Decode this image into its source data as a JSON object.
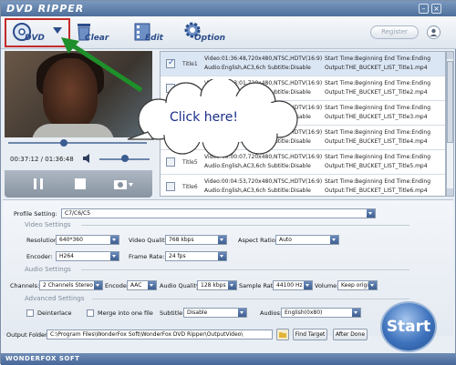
{
  "app": {
    "title": "DVD RIPPER",
    "brand": "WONDERFOX SOFT",
    "register_label": "Register"
  },
  "toolbar": {
    "dvd_label": "DVD",
    "clear_label": "Clear",
    "edit_label": "Edit",
    "option_label": "Option"
  },
  "player": {
    "time": "00:37:12 / 01:36:48",
    "seek_progress": 0.4,
    "volume_level": 0.5
  },
  "titles": [
    {
      "name": "Title1",
      "checked": true,
      "selected": true,
      "info1": "Video:01:36:48,720x480,NTSC,HDTV(16:9)",
      "info2": "Audio:English,AC3,6ch Subtitle:Disable",
      "out1": "Start Time:Beginning End Time:Ending",
      "out2": "Output:THE_BUCKET_LIST_Title1.mp4"
    },
    {
      "name": "Title2",
      "checked": false,
      "selected": false,
      "info1": "Video:00:03:01,720x480,NTSC,HDTV(16:9)",
      "info2": "Audio:English,AC3,6ch Subtitle:Disable",
      "out1": "Start Time:Beginning End Time:Ending",
      "out2": "Output:THE_BUCKET_LIST_Title2.mp4"
    },
    {
      "name": "Title3",
      "checked": false,
      "selected": false,
      "info1": "Video:00:00:45,720x480,NTSC,HDTV(16:9)",
      "info2": "Audio:English,AC3,6ch Subtitle:Disable",
      "out1": "Start Time:Beginning End Time:Ending",
      "out2": "Output:THE_BUCKET_LIST_Title3.mp4"
    },
    {
      "name": "Title4",
      "checked": false,
      "selected": false,
      "info1": "Video:00:02:10,720x480,NTSC,HDTV(16:9)",
      "info2": "Audio:English,AC3,6ch Subtitle:Disable",
      "out1": "Start Time:Beginning End Time:Ending",
      "out2": "Output:THE_BUCKET_LIST_Title4.mp4"
    },
    {
      "name": "Title5",
      "checked": false,
      "selected": false,
      "info1": "Video:00:00:07,720x480,NTSC,HDTV(16:9)",
      "info2": "Audio:English,AC3,6ch Subtitle:Disable",
      "out1": "Start Time:Beginning End Time:Ending",
      "out2": "Output:THE_BUCKET_LIST_Title5.mp4"
    },
    {
      "name": "Title6",
      "checked": false,
      "selected": false,
      "info1": "Video:00:04:53,720x480,NTSC,HDTV(16:9)",
      "info2": "Audio:English,AC3,6ch Subtitle:Disable",
      "out1": "Start Time:Beginning End Time:Ending",
      "out2": "Output:THE_BUCKET_LIST_Title6.mp4"
    }
  ],
  "callout": {
    "text": "Click here!"
  },
  "settings": {
    "profile_label": "Profile Setting:",
    "profile_value": "C7/C6/C5",
    "video_group": "Video Settings",
    "resolution_label": "Resolution:",
    "resolution_value": "640*360",
    "quality_label": "Video Quality:",
    "quality_value": "768 kbps",
    "aspect_label": "Aspect Ratio:",
    "aspect_value": "Auto",
    "encoder_label": "Encoder:",
    "encoder_value": "H264",
    "framerate_label": "Frame Rate:",
    "framerate_value": "24 fps",
    "audio_group": "Audio Settings",
    "channels_label": "Channels:",
    "channels_value": "2 Channels Stereo",
    "aencoder_label": "Encoder:",
    "aencoder_value": "AAC",
    "aquality_label": "Audio Quality:",
    "aquality_value": "128 kbps",
    "samplerate_label": "Sample Rate:",
    "samplerate_value": "44100 Hz",
    "volume_label": "Volume:",
    "volume_value": "Keep origina",
    "advanced_group": "Advanced Settings",
    "deinterlace_label": "Deinterlace",
    "merge_label": "Merge into one file",
    "subtitle_label": "Subtitle:",
    "subtitle_value": "Disable",
    "audios_label": "Audios:",
    "audios_value": "English(0x80)",
    "output_label": "Output Folder:",
    "output_value": "C:\\Program Files\\WonderFox Soft\\WonderFox DVD Ripper\\OutputVideo\\",
    "find_target_label": "Find Target",
    "after_done_label": "After Done",
    "start_label": "Start"
  }
}
